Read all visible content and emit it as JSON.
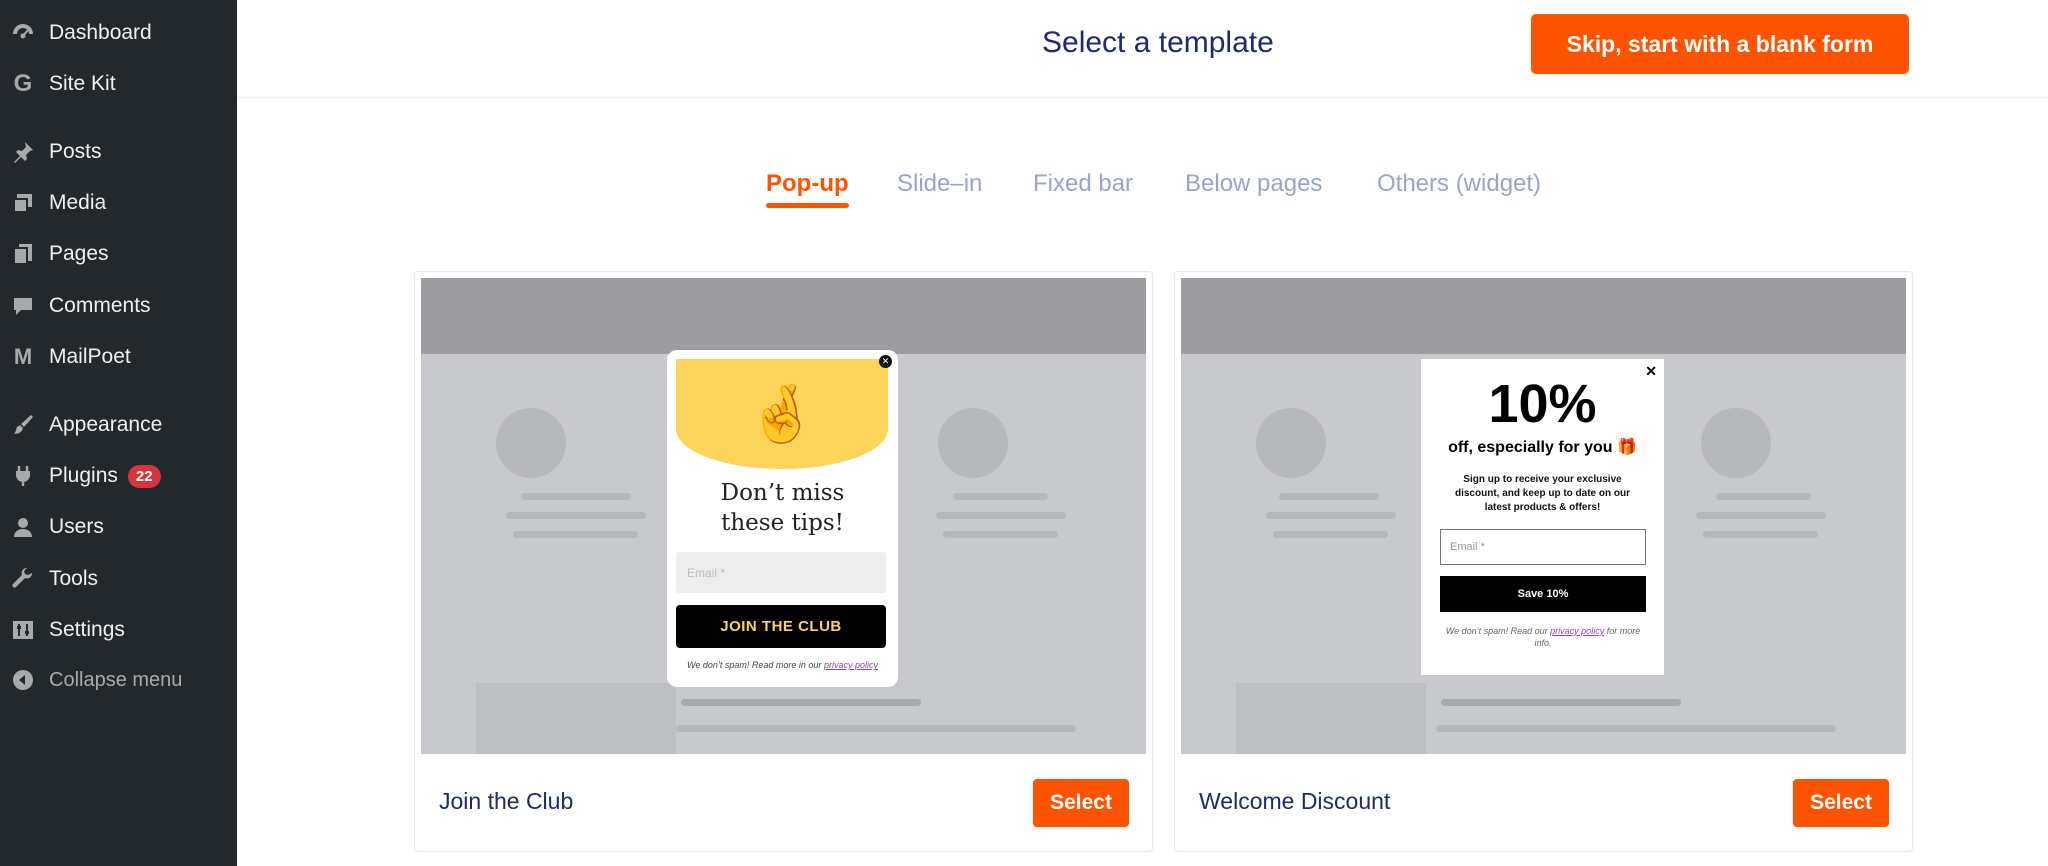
{
  "sidebar": {
    "items": [
      {
        "label": "Dashboard",
        "icon": "dashboard-icon"
      },
      {
        "label": "Site Kit",
        "icon": "google-g-icon"
      },
      {
        "label": "Posts",
        "icon": "pushpin-icon"
      },
      {
        "label": "Media",
        "icon": "media-icon"
      },
      {
        "label": "Pages",
        "icon": "pages-icon"
      },
      {
        "label": "Comments",
        "icon": "comment-icon"
      },
      {
        "label": "MailPoet",
        "icon": "mailpoet-icon"
      },
      {
        "label": "Appearance",
        "icon": "brush-icon"
      },
      {
        "label": "Plugins",
        "icon": "plugin-icon",
        "badge": "22"
      },
      {
        "label": "Users",
        "icon": "user-icon"
      },
      {
        "label": "Tools",
        "icon": "wrench-icon"
      },
      {
        "label": "Settings",
        "icon": "sliders-icon"
      },
      {
        "label": "Collapse menu",
        "icon": "collapse-arrow-icon"
      }
    ]
  },
  "header": {
    "title": "Select a template",
    "skip_button": "Skip, start with a blank form"
  },
  "tabs": [
    {
      "label": "Pop-up",
      "active": true
    },
    {
      "label": "Slide–in",
      "active": false
    },
    {
      "label": "Fixed bar",
      "active": false
    },
    {
      "label": "Below pages",
      "active": false
    },
    {
      "label": "Others (widget)",
      "active": false
    }
  ],
  "cards": [
    {
      "title": "Join the Club",
      "select_label": "Select",
      "preview": {
        "headline_line1": "Don’t miss",
        "headline_line2": "these tips!",
        "email_placeholder": "Email *",
        "button": "JOIN THE CLUB",
        "fine_print": "We don’t spam! Read more in our",
        "fine_link": "privacy policy",
        "emoji": "🤞"
      }
    },
    {
      "title": "Welcome Discount",
      "select_label": "Select",
      "preview": {
        "big": "10%",
        "sub": "off, especially for you 🎁",
        "desc": "Sign up to receive your exclusive discount, and keep up to date on our latest products & offers!",
        "email_placeholder": "Email *",
        "button": "Save 10%",
        "fine_print_pre": "We don’t spam! Read our",
        "fine_link": "privacy policy",
        "fine_print_post": "for more info."
      }
    }
  ],
  "colors": {
    "accent": "#fe5301",
    "title": "#1d2a6b",
    "sidebar": "#23282d",
    "tab_inactive": "#9ca3c6",
    "popup_yellow": "#fcd45a"
  }
}
